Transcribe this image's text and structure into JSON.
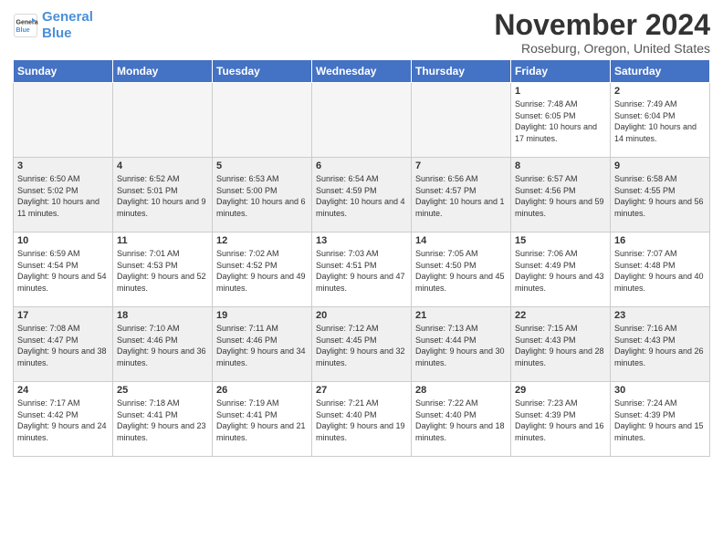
{
  "header": {
    "logo_line1": "General",
    "logo_line2": "Blue",
    "month": "November 2024",
    "location": "Roseburg, Oregon, United States"
  },
  "days_of_week": [
    "Sunday",
    "Monday",
    "Tuesday",
    "Wednesday",
    "Thursday",
    "Friday",
    "Saturday"
  ],
  "weeks": [
    [
      {
        "day": "",
        "info": ""
      },
      {
        "day": "",
        "info": ""
      },
      {
        "day": "",
        "info": ""
      },
      {
        "day": "",
        "info": ""
      },
      {
        "day": "",
        "info": ""
      },
      {
        "day": "1",
        "info": "Sunrise: 7:48 AM\nSunset: 6:05 PM\nDaylight: 10 hours and 17 minutes."
      },
      {
        "day": "2",
        "info": "Sunrise: 7:49 AM\nSunset: 6:04 PM\nDaylight: 10 hours and 14 minutes."
      }
    ],
    [
      {
        "day": "3",
        "info": "Sunrise: 6:50 AM\nSunset: 5:02 PM\nDaylight: 10 hours and 11 minutes."
      },
      {
        "day": "4",
        "info": "Sunrise: 6:52 AM\nSunset: 5:01 PM\nDaylight: 10 hours and 9 minutes."
      },
      {
        "day": "5",
        "info": "Sunrise: 6:53 AM\nSunset: 5:00 PM\nDaylight: 10 hours and 6 minutes."
      },
      {
        "day": "6",
        "info": "Sunrise: 6:54 AM\nSunset: 4:59 PM\nDaylight: 10 hours and 4 minutes."
      },
      {
        "day": "7",
        "info": "Sunrise: 6:56 AM\nSunset: 4:57 PM\nDaylight: 10 hours and 1 minute."
      },
      {
        "day": "8",
        "info": "Sunrise: 6:57 AM\nSunset: 4:56 PM\nDaylight: 9 hours and 59 minutes."
      },
      {
        "day": "9",
        "info": "Sunrise: 6:58 AM\nSunset: 4:55 PM\nDaylight: 9 hours and 56 minutes."
      }
    ],
    [
      {
        "day": "10",
        "info": "Sunrise: 6:59 AM\nSunset: 4:54 PM\nDaylight: 9 hours and 54 minutes."
      },
      {
        "day": "11",
        "info": "Sunrise: 7:01 AM\nSunset: 4:53 PM\nDaylight: 9 hours and 52 minutes."
      },
      {
        "day": "12",
        "info": "Sunrise: 7:02 AM\nSunset: 4:52 PM\nDaylight: 9 hours and 49 minutes."
      },
      {
        "day": "13",
        "info": "Sunrise: 7:03 AM\nSunset: 4:51 PM\nDaylight: 9 hours and 47 minutes."
      },
      {
        "day": "14",
        "info": "Sunrise: 7:05 AM\nSunset: 4:50 PM\nDaylight: 9 hours and 45 minutes."
      },
      {
        "day": "15",
        "info": "Sunrise: 7:06 AM\nSunset: 4:49 PM\nDaylight: 9 hours and 43 minutes."
      },
      {
        "day": "16",
        "info": "Sunrise: 7:07 AM\nSunset: 4:48 PM\nDaylight: 9 hours and 40 minutes."
      }
    ],
    [
      {
        "day": "17",
        "info": "Sunrise: 7:08 AM\nSunset: 4:47 PM\nDaylight: 9 hours and 38 minutes."
      },
      {
        "day": "18",
        "info": "Sunrise: 7:10 AM\nSunset: 4:46 PM\nDaylight: 9 hours and 36 minutes."
      },
      {
        "day": "19",
        "info": "Sunrise: 7:11 AM\nSunset: 4:46 PM\nDaylight: 9 hours and 34 minutes."
      },
      {
        "day": "20",
        "info": "Sunrise: 7:12 AM\nSunset: 4:45 PM\nDaylight: 9 hours and 32 minutes."
      },
      {
        "day": "21",
        "info": "Sunrise: 7:13 AM\nSunset: 4:44 PM\nDaylight: 9 hours and 30 minutes."
      },
      {
        "day": "22",
        "info": "Sunrise: 7:15 AM\nSunset: 4:43 PM\nDaylight: 9 hours and 28 minutes."
      },
      {
        "day": "23",
        "info": "Sunrise: 7:16 AM\nSunset: 4:43 PM\nDaylight: 9 hours and 26 minutes."
      }
    ],
    [
      {
        "day": "24",
        "info": "Sunrise: 7:17 AM\nSunset: 4:42 PM\nDaylight: 9 hours and 24 minutes."
      },
      {
        "day": "25",
        "info": "Sunrise: 7:18 AM\nSunset: 4:41 PM\nDaylight: 9 hours and 23 minutes."
      },
      {
        "day": "26",
        "info": "Sunrise: 7:19 AM\nSunset: 4:41 PM\nDaylight: 9 hours and 21 minutes."
      },
      {
        "day": "27",
        "info": "Sunrise: 7:21 AM\nSunset: 4:40 PM\nDaylight: 9 hours and 19 minutes."
      },
      {
        "day": "28",
        "info": "Sunrise: 7:22 AM\nSunset: 4:40 PM\nDaylight: 9 hours and 18 minutes."
      },
      {
        "day": "29",
        "info": "Sunrise: 7:23 AM\nSunset: 4:39 PM\nDaylight: 9 hours and 16 minutes."
      },
      {
        "day": "30",
        "info": "Sunrise: 7:24 AM\nSunset: 4:39 PM\nDaylight: 9 hours and 15 minutes."
      }
    ]
  ]
}
